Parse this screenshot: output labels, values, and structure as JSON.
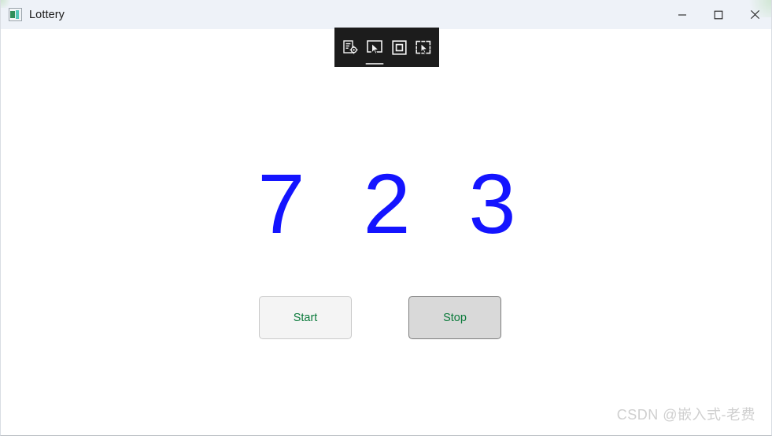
{
  "window": {
    "title": "Lottery",
    "icon": "app-window-image-icon",
    "controls": [
      {
        "name": "minimize",
        "glyph": "minimize-icon",
        "label": "Minimize"
      },
      {
        "name": "maximize",
        "glyph": "maximize-icon",
        "label": "Maximize"
      },
      {
        "name": "close",
        "glyph": "close-icon",
        "label": "Close"
      }
    ],
    "colors": {
      "titlebar_bg": "#eef2f8",
      "content_bg": "#ffffff",
      "border": "#d9dde3"
    }
  },
  "capture_toolbar": {
    "background": "#1c1c1c",
    "buttons": [
      {
        "name": "capture-settings-icon",
        "label": "Capture settings",
        "active": false
      },
      {
        "name": "window-snip-icon",
        "label": "Window snip",
        "active": true
      },
      {
        "name": "fullscreen-snip-icon",
        "label": "Fullscreen snip",
        "active": false
      },
      {
        "name": "freeform-snip-icon",
        "label": "Free-form snip",
        "active": false
      }
    ]
  },
  "main": {
    "lottery_number": "7 2 3",
    "lottery_number_color": "#1414ff",
    "digits": [
      "7",
      "2",
      "3"
    ],
    "buttons": {
      "start_label": "Start",
      "stop_label": "Stop",
      "text_color": "#0b7a3b",
      "start_state": "normal",
      "stop_state": "pressed"
    }
  },
  "watermark": {
    "text": "CSDN @嵌入式-老费",
    "color": "#cfcfcf"
  }
}
